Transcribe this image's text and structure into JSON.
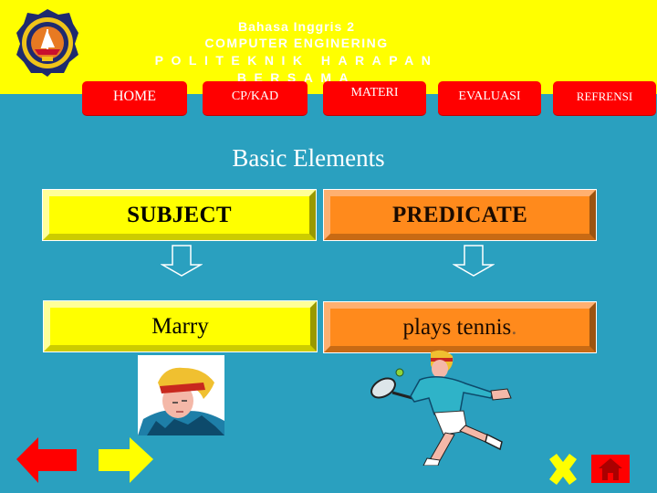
{
  "header": {
    "title_line1": "Bahasa Inggris 2",
    "title_line2": "COMPUTER ENGINERING",
    "title_line3": "POLITEKNIK HARAPAN  BERSAMA",
    "logo_icon": "institution-crest-logo",
    "background_color": "#ffff00"
  },
  "nav": {
    "items": [
      {
        "label": "HOME"
      },
      {
        "label": "CP/KAD"
      },
      {
        "label": "MATERI"
      },
      {
        "label": "EVALUASI"
      },
      {
        "label": "REFRENSI"
      }
    ],
    "button_color": "#ff0000"
  },
  "main": {
    "section_title": "Basic Elements",
    "columns": [
      {
        "header": "SUBJECT",
        "example": "Marry",
        "color": "#ffff00",
        "arrow_icon": "down-arrow-icon"
      },
      {
        "header": "PREDICATE",
        "example": "plays tennis",
        "example_suffix": ".",
        "color": "#ff8a1c",
        "arrow_icon": "down-arrow-icon"
      }
    ],
    "images": [
      {
        "name": "portrait-clipart",
        "desc": "woman with headband portrait"
      },
      {
        "name": "tennis-player-clipart",
        "desc": "tennis player hitting ball"
      }
    ]
  },
  "footer": {
    "back_icon": "left-arrow-icon",
    "next_icon": "right-arrow-icon",
    "close_icon": "close-x-icon",
    "home_icon": "house-icon"
  },
  "background_color": "#2aa0bf"
}
